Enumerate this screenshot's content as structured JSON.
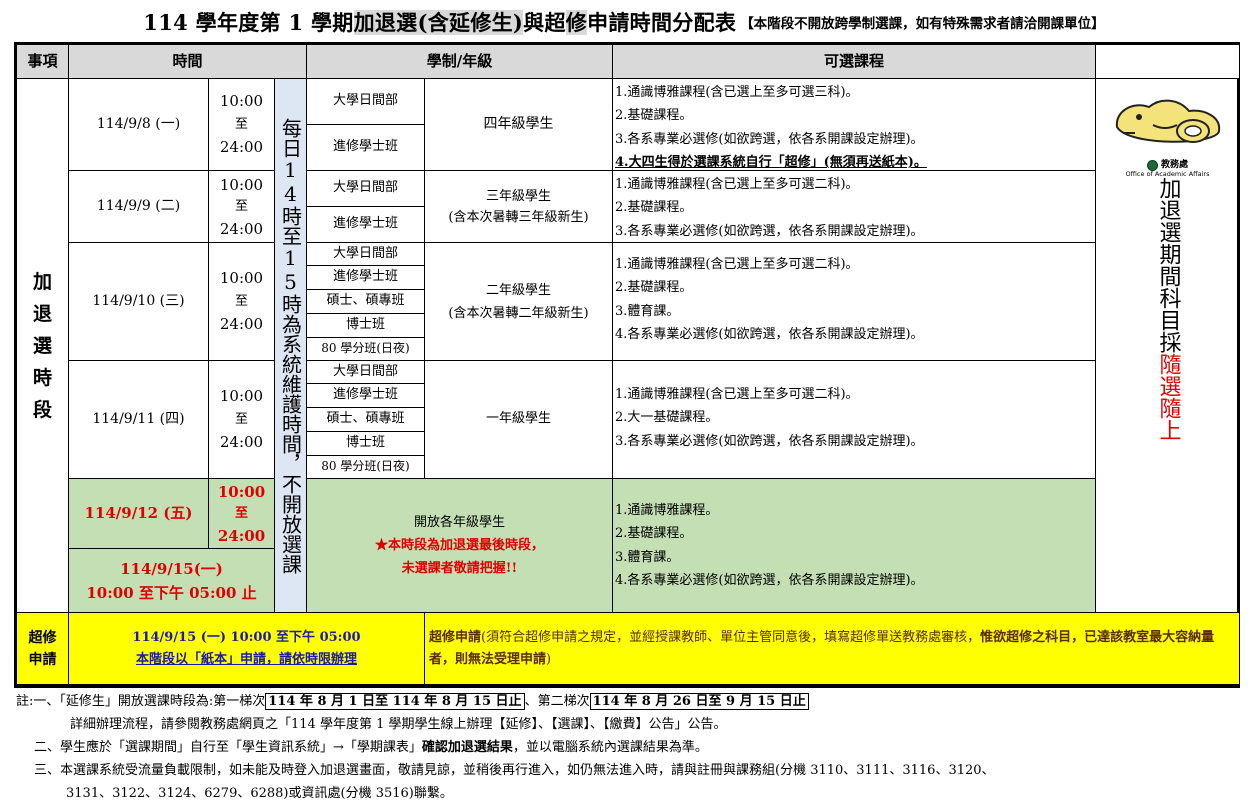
{
  "title": {
    "pre": "114 學年度第 1 學期",
    "hl1": "加退選(含延修生)",
    "mid": "與超",
    "hl2": "修",
    "post": "申請時間分配表",
    "note": "【本階段不開放跨學制選課，如有特殊需求者請洽開課單位】"
  },
  "headers": {
    "item": "事項",
    "time": "時間",
    "grade": "學制/年級",
    "courses": "可選課程"
  },
  "phase_label": [
    "加",
    "退",
    "選",
    "時",
    "段"
  ],
  "maintenance": "每日14時至15時為系統維護時間，不開放選課",
  "rows": [
    {
      "date": "114/9/8 (一)",
      "time": [
        "10:00",
        "至",
        "24:00"
      ],
      "systems": [
        "大學日間部",
        "進修學士班"
      ],
      "grade": "四年級學生",
      "courses": [
        "1.通識博雅課程(含已選上至多可選三科)。",
        "2.基礎課程。",
        "3.各系專業必選修(如欲跨選，依各系開課設定辦理)。",
        "4.大四生得於選課系統自行「超修」(無須再送紙本)。"
      ]
    },
    {
      "date": "114/9/9 (二)",
      "time": [
        "10:00",
        "至",
        "24:00"
      ],
      "systems": [
        "大學日間部",
        "進修學士班"
      ],
      "grade": "三年級學生",
      "grade_note": "(含本次暑轉三年級新生)",
      "courses": [
        "1.通識博雅課程(含已選上至多可選二科)。",
        "2.基礎課程。",
        "3.各系專業必選修(如欲跨選，依各系開課設定辦理)。"
      ]
    },
    {
      "date": "114/9/10 (三)",
      "time": [
        "10:00",
        "至",
        "24:00"
      ],
      "systems": [
        "大學日間部",
        "進修學士班",
        "碩士、碩專班",
        "博士班",
        "80 學分班(日夜)"
      ],
      "grade": "二年級學生",
      "grade_note": "(含本次暑轉二年級新生)",
      "courses": [
        "1.通識博雅課程(含已選上至多可選二科)。",
        "2.基礎課程。",
        "3.體育課。",
        "4.各系專業必選修(如欲跨選，依各系開課設定辦理)。"
      ]
    },
    {
      "date": "114/9/11 (四)",
      "time": [
        "10:00",
        "至",
        "24:00"
      ],
      "systems": [
        "大學日間部",
        "進修學士班",
        "碩士、碩專班",
        "博士班",
        "80 學分班(日夜)"
      ],
      "grade": "一年級學生",
      "courses": [
        "1.通識博雅課程(含已選上至多可選二科)。",
        "2.大一基礎課程。",
        "3.各系專業必選修(如欲跨選，依各系開課設定辦理)。"
      ]
    }
  ],
  "final": {
    "date1": "114/9/12 (五)",
    "time1": [
      "10:00",
      "至",
      "24:00"
    ],
    "date2": "114/9/15(一)",
    "time2": "10:00 至下午 05:00 止",
    "open": "開放各年級學生",
    "warn1": "★本時段為加退選最後時段，",
    "warn2": "未選課者敬請把握!!",
    "courses": [
      "1.通識博雅課程。",
      "2.基礎課程。",
      "3.體育課。",
      "4.各系專業必選修(如欲跨選，依各系開課設定辦理)。"
    ]
  },
  "overload": {
    "label": [
      "超修",
      "申請"
    ],
    "time": "114/9/15 (一) 10:00 至下午 05:00",
    "paper": "本階段以「紙本」申請，請依時限辦理",
    "desc_bold": "超修申請",
    "desc_text": "(須符合超修申請之規定，並經授課教師、單位主管同意後，填寫超修單送教務處審核，",
    "desc_bold2": "惟欲超修之科目，已達該教室最大容納量者，則無法受理申請",
    "desc_end": ")"
  },
  "side": {
    "logo_text": "教務處",
    "logo_en": "Office of Academic Affairs",
    "black": "加退選期間科目採",
    "red": "隨選隨上"
  },
  "notes": {
    "n1_prefix": "註:一、「延修生」開放選課時段為:第一梯次",
    "n1_box1": "114 年 8 月 1 日至 114 年 8 月 15 日止",
    "n1_mid": "、第二梯次",
    "n1_box2": "114 年 8 月 26 日至 9 月 15 日止",
    "n1b": "詳細辦理流程，請參閱教務處網頁之「114 學年度第 1 學期學生線上辦理【延修】、【選課】、【繳費】公告」公告。",
    "n2_pre": "二、學生應於「選課期間」自行至「學生資訊系統」→「學期課表」",
    "n2_bold": "確認加退選結果",
    "n2_post": "，並以電腦系統內選課結果為準。",
    "n3a": "三、本選課系統受流量負載限制，如未能及時登入加退選畫面，敬請見諒，並稍後再行進入，如仍無法進入時，請與註冊與課務組(分機 3110、3111、3116、3120、",
    "n3b": "3131、3122、3124、6279、6288)或資訊處(分機 3516)聯繫。"
  },
  "colors": {
    "header": "#d9d9d9",
    "green": "#c4dfb4",
    "yellow": "#ffff00",
    "red": "#e00000",
    "maint": "#dde6f3"
  }
}
